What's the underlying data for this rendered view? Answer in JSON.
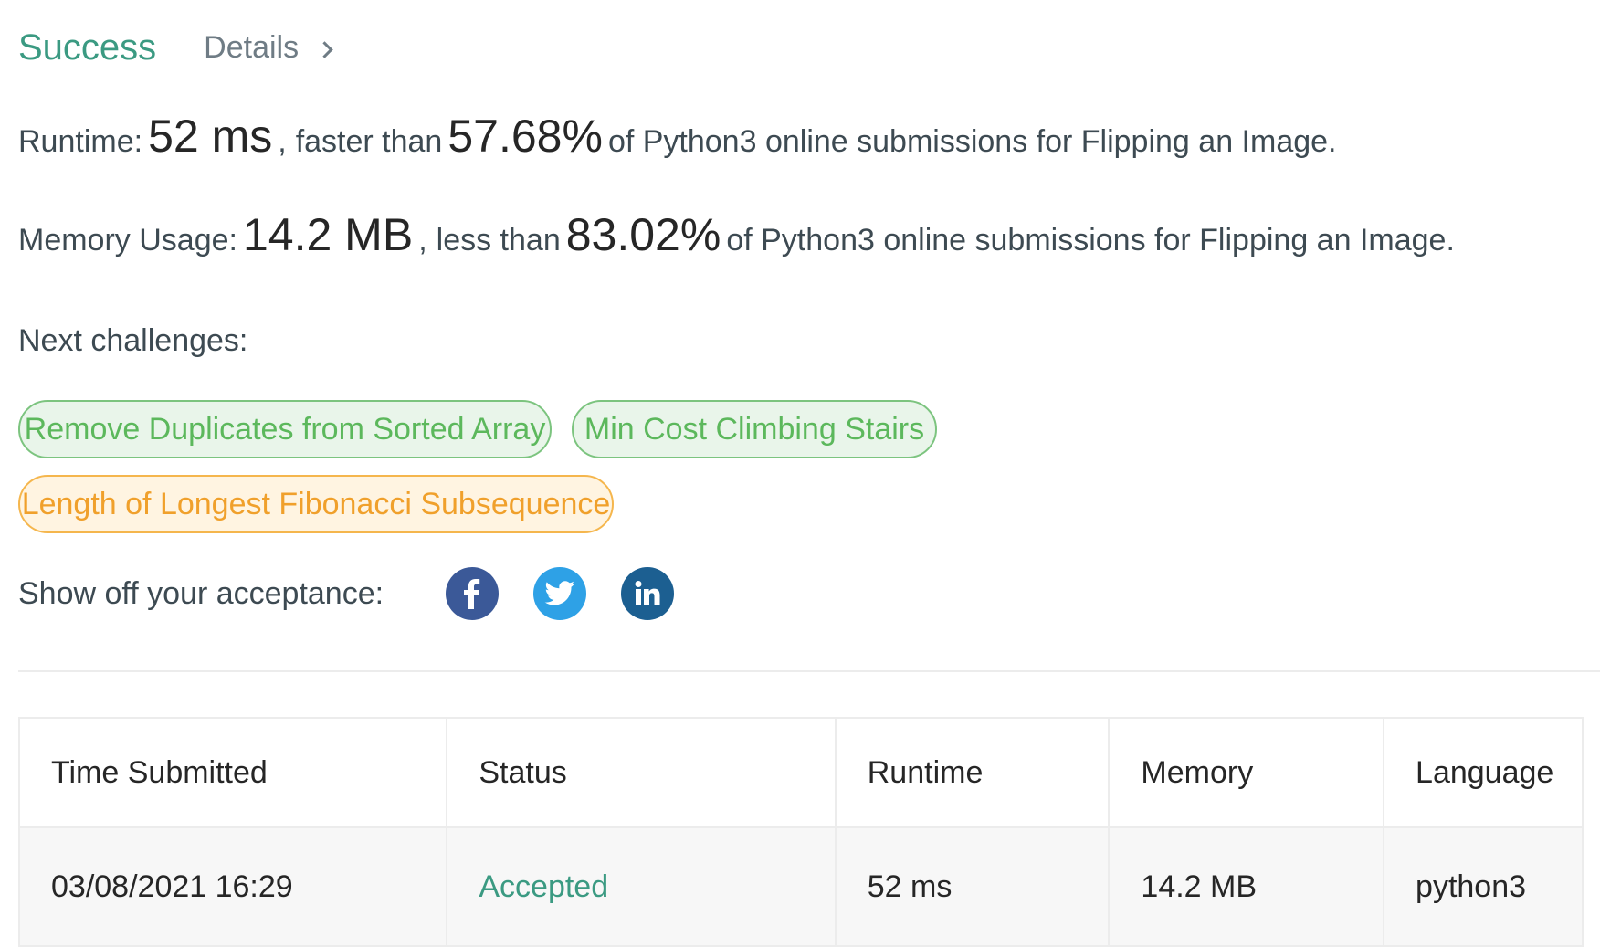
{
  "header": {
    "status": "Success",
    "details_label": "Details"
  },
  "runtime": {
    "label": "Runtime:",
    "value": "52 ms",
    "comparison": "faster than",
    "percent": "57.68%",
    "suffix": "of Python3 online submissions for Flipping an Image."
  },
  "memory": {
    "label": "Memory Usage:",
    "value": "14.2 MB",
    "comparison": "less than",
    "percent": "83.02%",
    "suffix": "of Python3 online submissions for Flipping an Image."
  },
  "next": {
    "label": "Next challenges:",
    "challenges": [
      {
        "title": "Remove Duplicates from Sorted Array",
        "difficulty": "easy"
      },
      {
        "title": "Min Cost Climbing Stairs",
        "difficulty": "easy"
      },
      {
        "title": "Length of Longest Fibonacci Subsequence",
        "difficulty": "medium"
      }
    ]
  },
  "share": {
    "label": "Show off your acceptance:",
    "icons": [
      "facebook-icon",
      "twitter-icon",
      "linkedin-icon"
    ]
  },
  "table": {
    "headers": [
      "Time Submitted",
      "Status",
      "Runtime",
      "Memory",
      "Language"
    ],
    "rows": [
      {
        "time": "03/08/2021 16:29",
        "status": "Accepted",
        "runtime": "52 ms",
        "memory": "14.2 MB",
        "language": "python3"
      }
    ]
  },
  "colors": {
    "success": "#3b9a82",
    "easy": "#5cb85c",
    "medium": "#f0a02b",
    "facebook": "#3b5998",
    "twitter": "#2ea1e6",
    "linkedin": "#1c5f91"
  }
}
